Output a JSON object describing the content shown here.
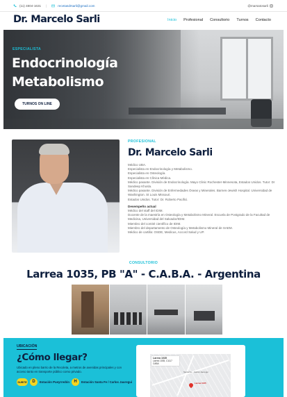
{
  "topbar": {
    "phone": "(11) 4804-1631",
    "email": "recetasdrsarli@gmail.com",
    "instagram": "@marsatosarli"
  },
  "header": {
    "logo": "Dr. Marcelo Sarli",
    "nav": [
      {
        "label": "Inicio",
        "active": true
      },
      {
        "label": "Profesional",
        "active": false
      },
      {
        "label": "Consultorio",
        "active": false
      },
      {
        "label": "Turnos",
        "active": false
      },
      {
        "label": "Contacto",
        "active": false
      }
    ]
  },
  "hero": {
    "kicker": "ESPECIALISTA",
    "title_line1": "Endocrinología",
    "title_line2": "Metabolismo",
    "button": "TURNOS ON LINE"
  },
  "profile": {
    "kicker": "PROFESIONAL",
    "name": "Dr. Marcelo Sarli",
    "items": [
      "Médico UBA.",
      "Especialista en Endocrinología y Metabolismo.",
      "Especialista en Osteología.",
      "Especialista en Clínica Médica.",
      "Médico pasante. División de Endocrinología. Mayo Clinic Rochester-Minnesota, Estados Unidos. Tutor: Dr Sandeep Khosla.",
      "Médico pasante. División de Enfermedades Óseas y Minerales. Barnes-Jewish Hospital. Universidad de Washington. St Louis Missouri.",
      "Estados Unidos. Tutor: Dr. Roberto Pacifici."
    ],
    "subhead": "Desempeño actual",
    "current": [
      "Médico del staff del IDIM.",
      "Docente de la maestría en Osteología y Metabolismo Mineral. Escuela de Postgrado de la Facultad de Medicina, Universidad del Salvador/IDIM.",
      "Miembro del comité científico de IDIM.",
      "Miembro del departamento de Osteología y Metabolismo Mineral de SAEM.",
      "Médico de cartilla: OSDE, Medicus, Accord Salud y UP."
    ]
  },
  "consultorio": {
    "kicker": "CONSULTORIO",
    "address": "Larrea 1035, PB \"A\" - C.A.B.A. - Argentina"
  },
  "ubicacion": {
    "kicker": "UBICACIÓN",
    "title": "¿Cómo llegar?",
    "text": "Ubicado en pleno barrio de la Recoleta, a metros de avenidas principales y con acceso tanto en transporte público como privado.",
    "subte_badge": "SUBTE",
    "line_d": "D",
    "station_d": "Estación Pueyrredón",
    "line_h": "H",
    "station_h": "Estación Santa Fe / Carlos Jauregui",
    "map": {
      "info_title": "Larrea 1035",
      "info_addr": "Larrea 1035, C1117 CABA",
      "station_label": "Santa Fe - Carlos Jauregui",
      "pin_label": "Larrea 1035"
    }
  },
  "colors": {
    "accent": "#1bc0d8",
    "navy": "#0e1f3e",
    "yellow": "#f4d51f"
  }
}
